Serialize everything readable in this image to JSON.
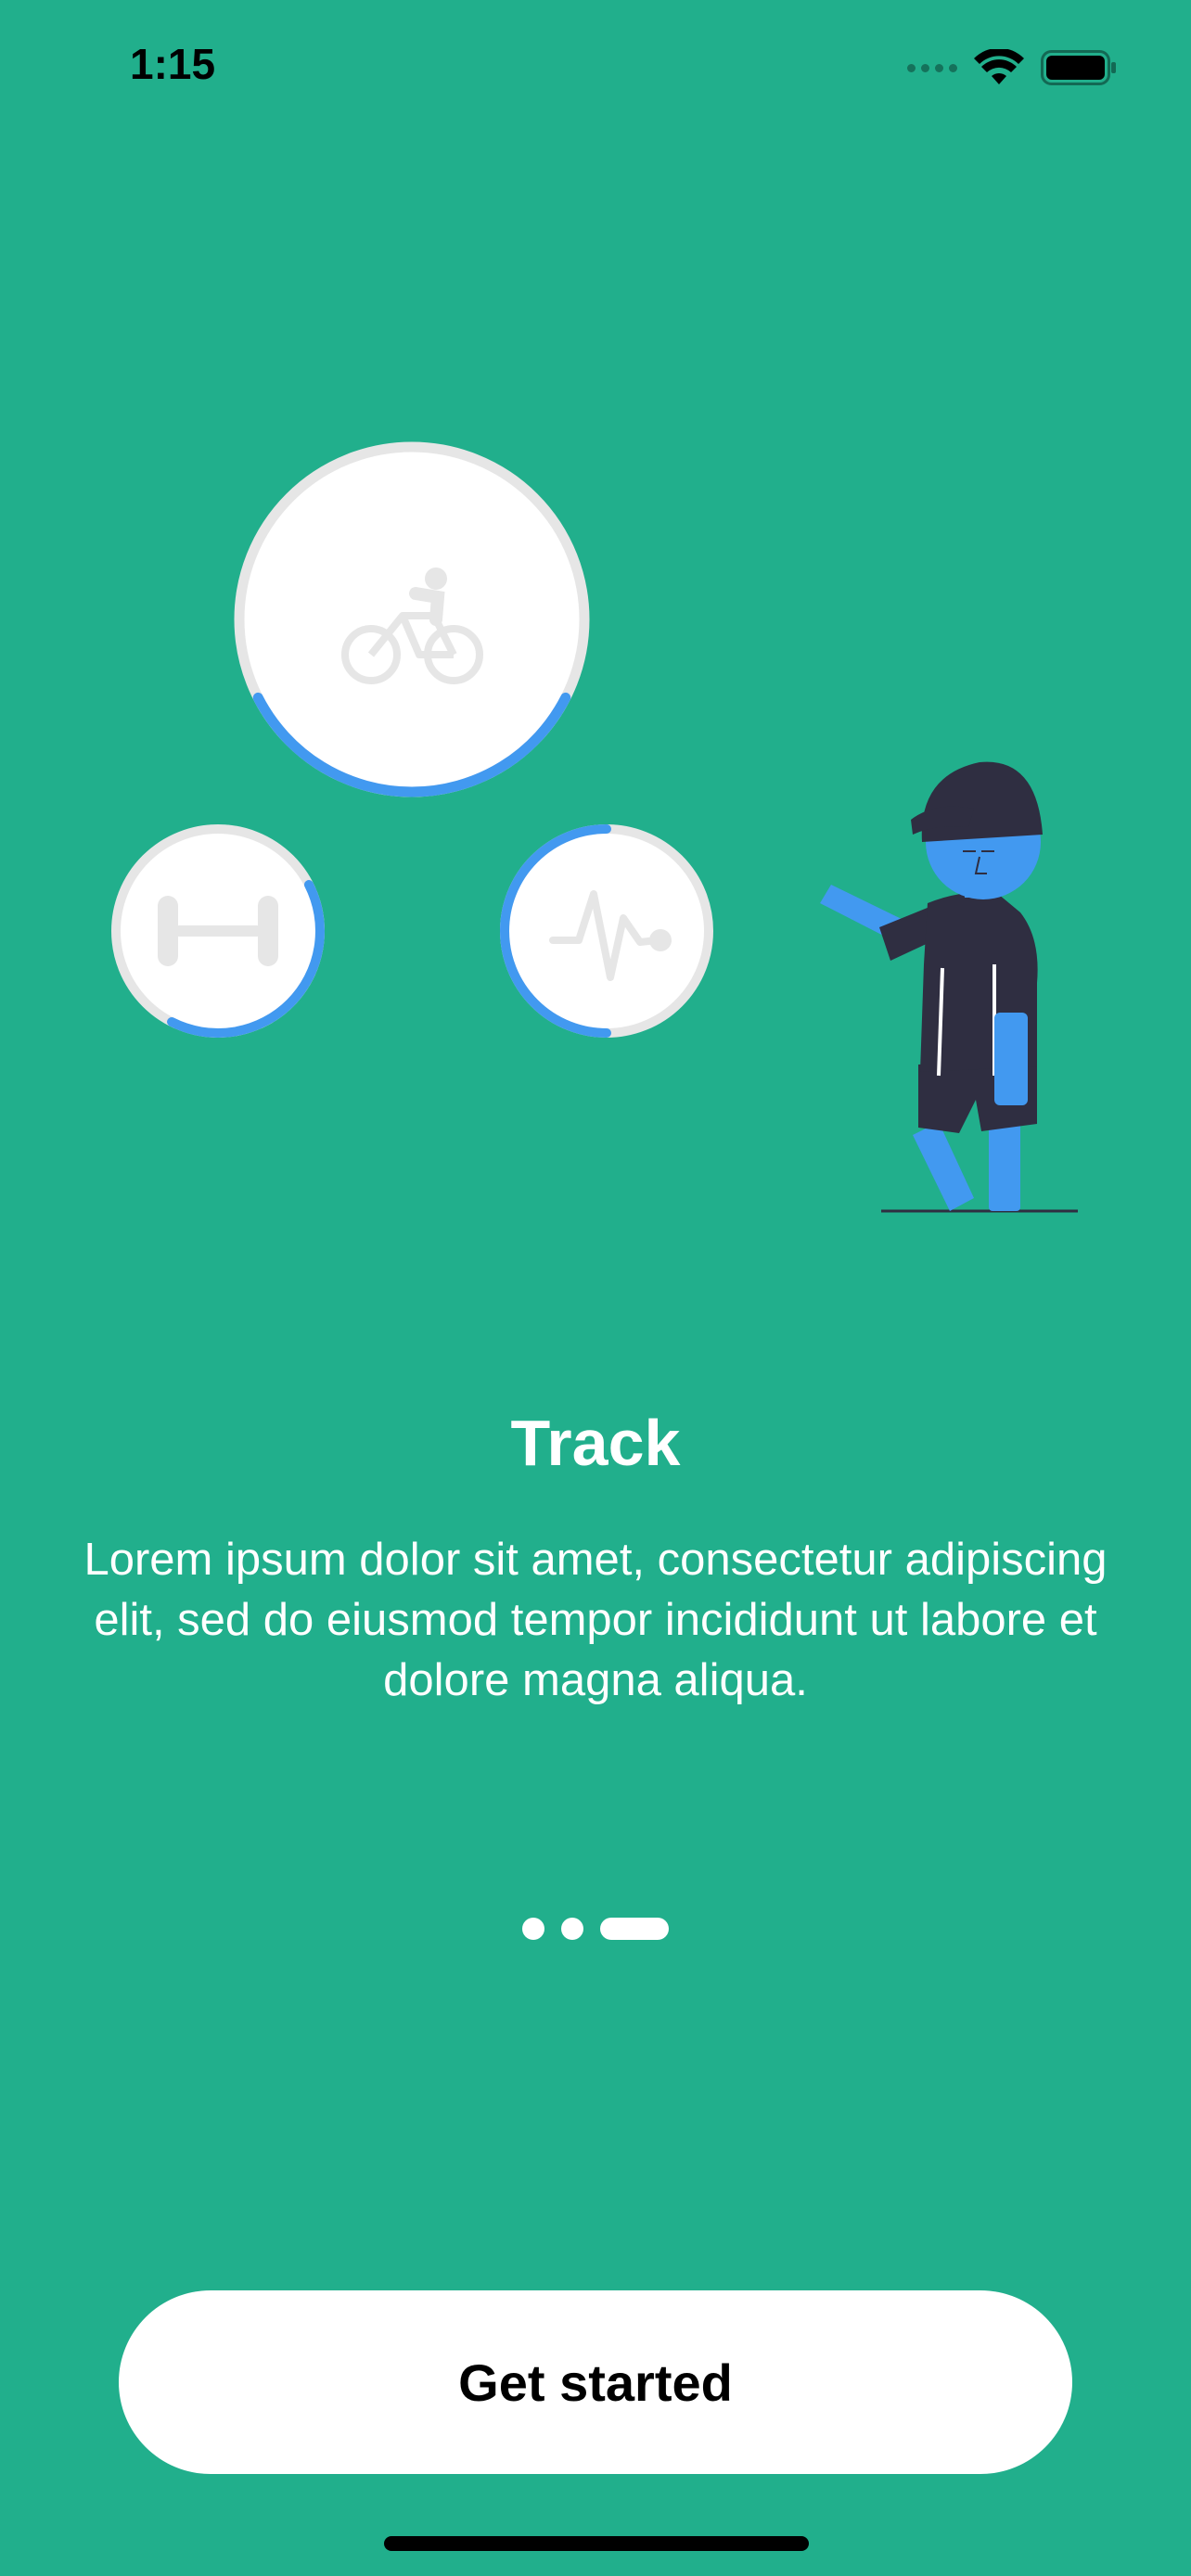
{
  "theme": {
    "background": "#21AF8C",
    "accent_blue": "#4299F0",
    "ring_gray": "#E6E6E6",
    "figure_dark": "#2F2E41",
    "button_bg": "#FFFFFF",
    "button_text": "#000000"
  },
  "status_bar": {
    "time": "1:15",
    "icons": [
      "cellular-signal-icon",
      "wifi-icon",
      "battery-icon"
    ]
  },
  "illustration": {
    "activities": [
      {
        "icon": "bicycle-icon",
        "progress": 0.35
      },
      {
        "icon": "dumbbell-icon",
        "progress": 0.4
      },
      {
        "icon": "heartbeat-icon",
        "progress": 0.5
      }
    ],
    "figure": "person-pointing-figure"
  },
  "onboarding": {
    "title": "Track",
    "description": "Lorem ipsum dolor sit amet, consectetur adipiscing elit, sed do eiusmod tempor incididunt ut labore et dolore magna aliqua."
  },
  "pager": {
    "total": 3,
    "current": 3
  },
  "actions": {
    "get_started_label": "Get started"
  }
}
